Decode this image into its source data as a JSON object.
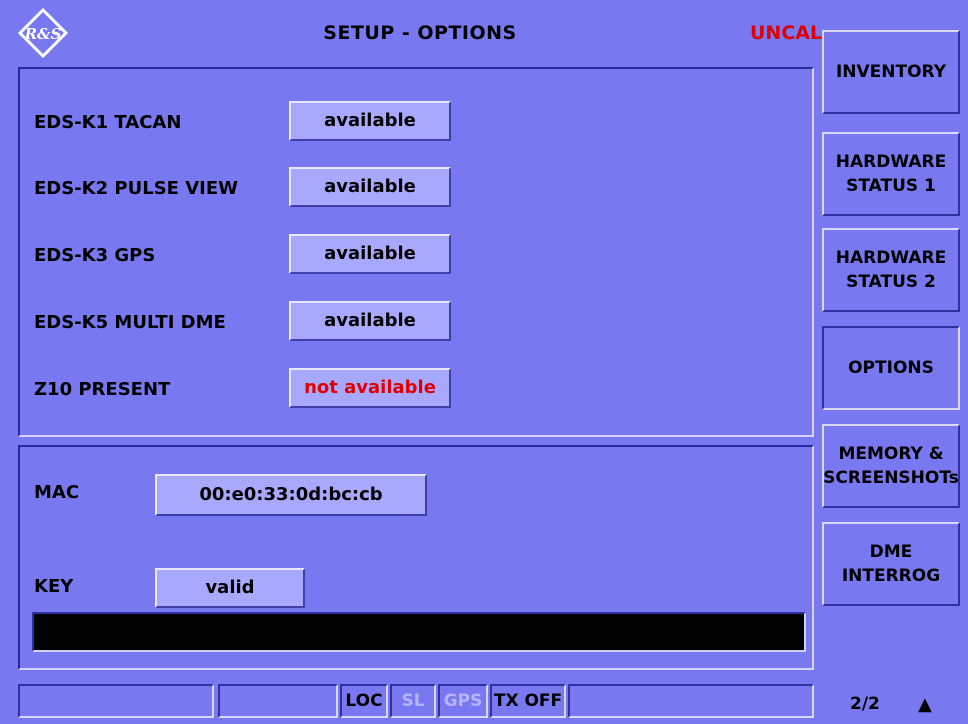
{
  "header": {
    "title": "SETUP - OPTIONS",
    "status": "UNCAL",
    "logo_text": "R&S"
  },
  "options": [
    {
      "label": "EDS-K1  TACAN",
      "value": "available"
    },
    {
      "label": "EDS-K2  PULSE VIEW",
      "value": "available"
    },
    {
      "label": "EDS-K3  GPS",
      "value": "available"
    },
    {
      "label": "EDS-K5  MULTI DME",
      "value": "available"
    },
    {
      "label": "Z10 PRESENT",
      "value": "not available"
    }
  ],
  "mac": {
    "label": "MAC",
    "value": "00:e0:33:0d:bc:cb"
  },
  "key": {
    "label": "KEY",
    "value": "valid"
  },
  "softkeys": [
    {
      "line1": "INVENTORY",
      "line2": ""
    },
    {
      "line1": "HARDWARE",
      "line2": "STATUS 1"
    },
    {
      "line1": "HARDWARE",
      "line2": "STATUS 2"
    },
    {
      "line1": "OPTIONS",
      "line2": ""
    },
    {
      "line1": "MEMORY &",
      "line2": "SCREENSHOTs"
    },
    {
      "line1": "DME",
      "line2": "INTERROG"
    }
  ],
  "statusbar": {
    "loc": "LOC",
    "sl": "SL",
    "gps": "GPS",
    "tx": "TX OFF"
  },
  "pager": {
    "page": "2/2",
    "arrow": "▲"
  },
  "colors": {
    "background": "#7878f0",
    "value_box": "#a8a8ff",
    "alert": "#e00000",
    "inactive_text": "#b4b4ff"
  }
}
